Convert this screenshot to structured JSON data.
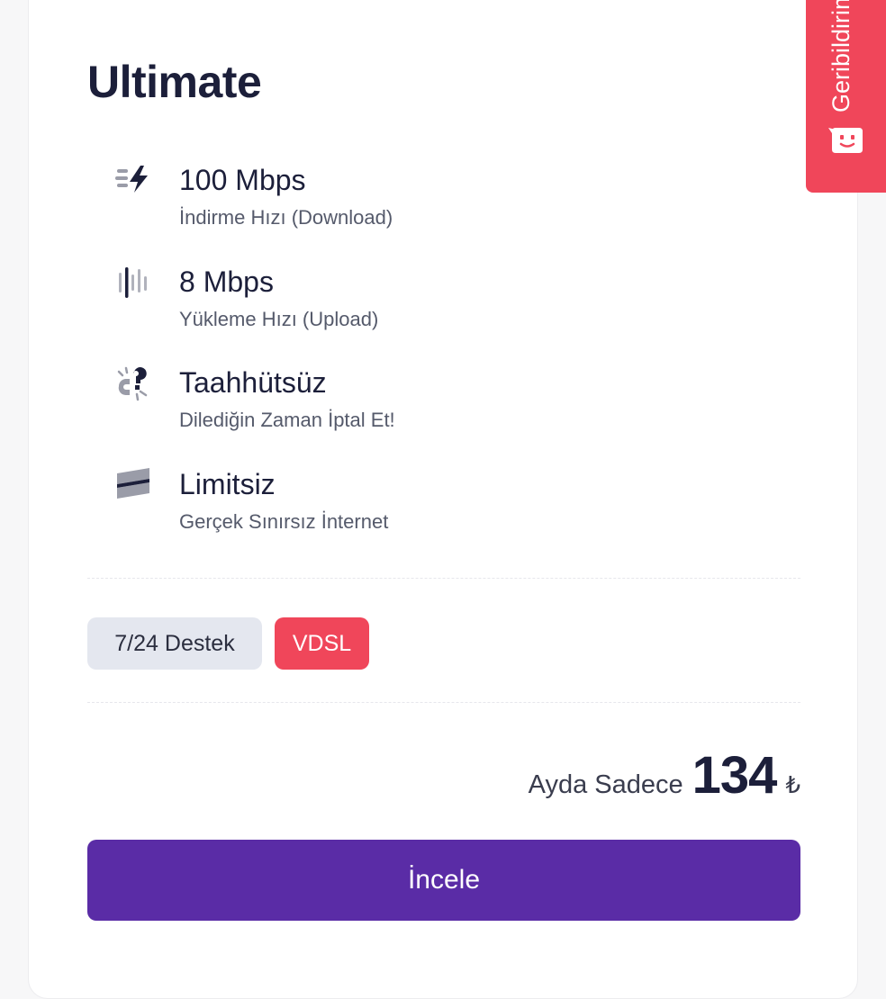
{
  "plan": {
    "title": "Ultimate"
  },
  "features": [
    {
      "icon": "download-speed-icon",
      "title": "100 Mbps",
      "subtitle": "İndirme Hızı (Download)"
    },
    {
      "icon": "upload-bars-icon",
      "title": "8 Mbps",
      "subtitle": "Yükleme Hızı (Upload)"
    },
    {
      "icon": "no-commitment-icon",
      "title": "Taahhütsüz",
      "subtitle": "Dilediğin Zaman İptal Et!"
    },
    {
      "icon": "unlimited-icon",
      "title": "Limitsiz",
      "subtitle": "Gerçek Sınırsız İnternet"
    }
  ],
  "badges": {
    "support": "7/24 Destek",
    "technology": "VDSL"
  },
  "price": {
    "label": "Ayda Sadece",
    "amount": "134",
    "currency": "₺"
  },
  "cta": {
    "label": "İncele"
  },
  "feedback": {
    "label": "Geribildirim",
    "icon": "smile-face-icon"
  },
  "colors": {
    "primary": "#5a2ca6",
    "accent": "#f0465a",
    "text_dark": "#1c1f3a",
    "badge_bg": "#e4e7ef"
  }
}
